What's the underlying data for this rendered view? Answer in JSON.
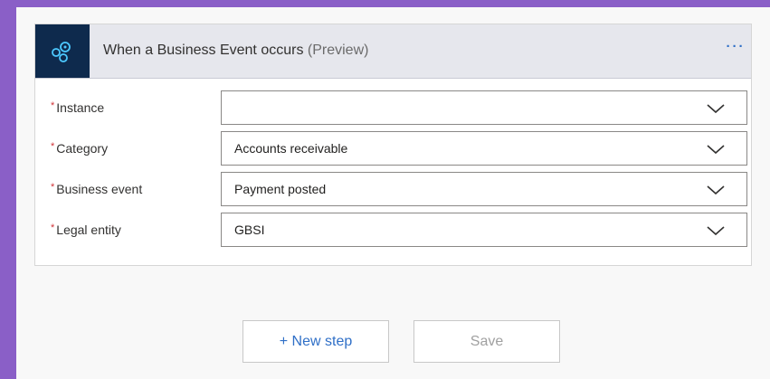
{
  "trigger": {
    "icon": "business-event-icon",
    "title": "When a Business Event occurs",
    "title_suffix": "(Preview)",
    "more_label": "···",
    "required_marker": "*"
  },
  "fields": [
    {
      "label": "Instance",
      "value": ""
    },
    {
      "label": "Category",
      "value": "Accounts receivable"
    },
    {
      "label": "Business event",
      "value": "Payment posted"
    },
    {
      "label": "Legal entity",
      "value": "GBSI"
    }
  ],
  "actions": {
    "new_step_label": "+ New step",
    "save_label": "Save"
  },
  "colors": {
    "background": "#8a5fc7",
    "header_icon_bg": "#0e2a4d",
    "accent": "#2f6fc7",
    "required": "#d13438"
  }
}
